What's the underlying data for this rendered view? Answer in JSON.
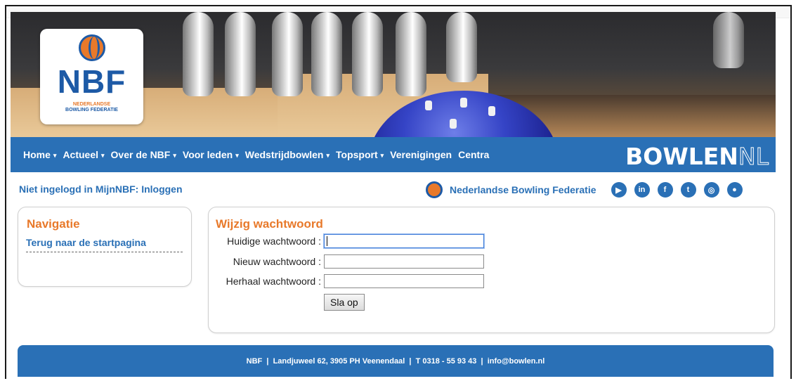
{
  "header": {
    "logo_text": "NBF",
    "logo_sub_1": "NEDERLANDSE",
    "logo_sub_2": "BOWLING FEDERATIE"
  },
  "nav": {
    "items": [
      {
        "label": "Home",
        "dropdown": true
      },
      {
        "label": "Actueel",
        "dropdown": true
      },
      {
        "label": "Over de NBF",
        "dropdown": true
      },
      {
        "label": "Voor leden",
        "dropdown": true
      },
      {
        "label": "Wedstrijdbowlen",
        "dropdown": true
      },
      {
        "label": "Topsport",
        "dropdown": true
      },
      {
        "label": "Verenigingen",
        "dropdown": false
      },
      {
        "label": "Centra",
        "dropdown": false
      }
    ],
    "brand_bold": "BOWLEN",
    "brand_outline": "NL"
  },
  "subheader": {
    "login_text": "Niet ingelogd in MijnNBF: Inloggen",
    "federation_name": "Nederlandse Bowling Federatie",
    "social_icons": [
      "youtube-icon",
      "linkedin-icon",
      "facebook-icon",
      "twitter-icon",
      "instagram-icon",
      "bowling-ball-icon"
    ]
  },
  "sidebar": {
    "title": "Navigatie",
    "link": "Terug naar de startpagina"
  },
  "form": {
    "title": "Wijzig wachtwoord",
    "fields": [
      {
        "label": "Huidige wachtwoord :",
        "value": ""
      },
      {
        "label": "Nieuw wachtwoord :",
        "value": ""
      },
      {
        "label": "Herhaal wachtwoord :",
        "value": ""
      }
    ],
    "submit_label": "Sla op"
  },
  "footer": {
    "text": "NBF  |  Landjuweel 62, 3905 PH Veenendaal  |  T 0318 - 55 93 43  |  info@bowlen.nl"
  },
  "colors": {
    "primary": "#2a70b6",
    "accent": "#e8792a"
  }
}
